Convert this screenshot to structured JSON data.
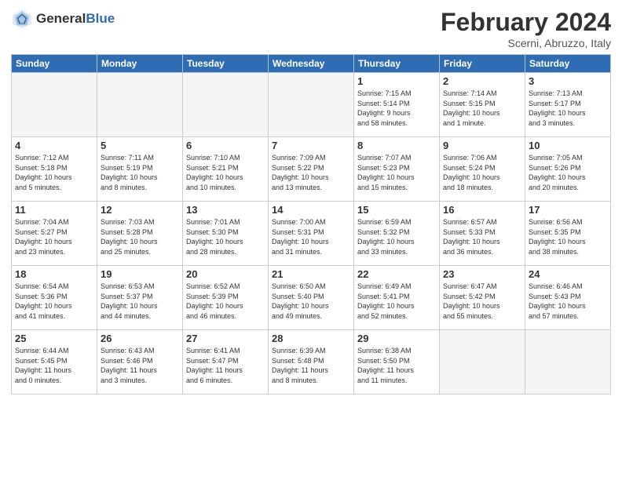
{
  "header": {
    "logo_general": "General",
    "logo_blue": "Blue",
    "month_title": "February 2024",
    "location": "Scerni, Abruzzo, Italy"
  },
  "calendar": {
    "days_of_week": [
      "Sunday",
      "Monday",
      "Tuesday",
      "Wednesday",
      "Thursday",
      "Friday",
      "Saturday"
    ],
    "weeks": [
      [
        {
          "day": "",
          "info": ""
        },
        {
          "day": "",
          "info": ""
        },
        {
          "day": "",
          "info": ""
        },
        {
          "day": "",
          "info": ""
        },
        {
          "day": "1",
          "info": "Sunrise: 7:15 AM\nSunset: 5:14 PM\nDaylight: 9 hours\nand 58 minutes."
        },
        {
          "day": "2",
          "info": "Sunrise: 7:14 AM\nSunset: 5:15 PM\nDaylight: 10 hours\nand 1 minute."
        },
        {
          "day": "3",
          "info": "Sunrise: 7:13 AM\nSunset: 5:17 PM\nDaylight: 10 hours\nand 3 minutes."
        }
      ],
      [
        {
          "day": "4",
          "info": "Sunrise: 7:12 AM\nSunset: 5:18 PM\nDaylight: 10 hours\nand 5 minutes."
        },
        {
          "day": "5",
          "info": "Sunrise: 7:11 AM\nSunset: 5:19 PM\nDaylight: 10 hours\nand 8 minutes."
        },
        {
          "day": "6",
          "info": "Sunrise: 7:10 AM\nSunset: 5:21 PM\nDaylight: 10 hours\nand 10 minutes."
        },
        {
          "day": "7",
          "info": "Sunrise: 7:09 AM\nSunset: 5:22 PM\nDaylight: 10 hours\nand 13 minutes."
        },
        {
          "day": "8",
          "info": "Sunrise: 7:07 AM\nSunset: 5:23 PM\nDaylight: 10 hours\nand 15 minutes."
        },
        {
          "day": "9",
          "info": "Sunrise: 7:06 AM\nSunset: 5:24 PM\nDaylight: 10 hours\nand 18 minutes."
        },
        {
          "day": "10",
          "info": "Sunrise: 7:05 AM\nSunset: 5:26 PM\nDaylight: 10 hours\nand 20 minutes."
        }
      ],
      [
        {
          "day": "11",
          "info": "Sunrise: 7:04 AM\nSunset: 5:27 PM\nDaylight: 10 hours\nand 23 minutes."
        },
        {
          "day": "12",
          "info": "Sunrise: 7:03 AM\nSunset: 5:28 PM\nDaylight: 10 hours\nand 25 minutes."
        },
        {
          "day": "13",
          "info": "Sunrise: 7:01 AM\nSunset: 5:30 PM\nDaylight: 10 hours\nand 28 minutes."
        },
        {
          "day": "14",
          "info": "Sunrise: 7:00 AM\nSunset: 5:31 PM\nDaylight: 10 hours\nand 31 minutes."
        },
        {
          "day": "15",
          "info": "Sunrise: 6:59 AM\nSunset: 5:32 PM\nDaylight: 10 hours\nand 33 minutes."
        },
        {
          "day": "16",
          "info": "Sunrise: 6:57 AM\nSunset: 5:33 PM\nDaylight: 10 hours\nand 36 minutes."
        },
        {
          "day": "17",
          "info": "Sunrise: 6:56 AM\nSunset: 5:35 PM\nDaylight: 10 hours\nand 38 minutes."
        }
      ],
      [
        {
          "day": "18",
          "info": "Sunrise: 6:54 AM\nSunset: 5:36 PM\nDaylight: 10 hours\nand 41 minutes."
        },
        {
          "day": "19",
          "info": "Sunrise: 6:53 AM\nSunset: 5:37 PM\nDaylight: 10 hours\nand 44 minutes."
        },
        {
          "day": "20",
          "info": "Sunrise: 6:52 AM\nSunset: 5:39 PM\nDaylight: 10 hours\nand 46 minutes."
        },
        {
          "day": "21",
          "info": "Sunrise: 6:50 AM\nSunset: 5:40 PM\nDaylight: 10 hours\nand 49 minutes."
        },
        {
          "day": "22",
          "info": "Sunrise: 6:49 AM\nSunset: 5:41 PM\nDaylight: 10 hours\nand 52 minutes."
        },
        {
          "day": "23",
          "info": "Sunrise: 6:47 AM\nSunset: 5:42 PM\nDaylight: 10 hours\nand 55 minutes."
        },
        {
          "day": "24",
          "info": "Sunrise: 6:46 AM\nSunset: 5:43 PM\nDaylight: 10 hours\nand 57 minutes."
        }
      ],
      [
        {
          "day": "25",
          "info": "Sunrise: 6:44 AM\nSunset: 5:45 PM\nDaylight: 11 hours\nand 0 minutes."
        },
        {
          "day": "26",
          "info": "Sunrise: 6:43 AM\nSunset: 5:46 PM\nDaylight: 11 hours\nand 3 minutes."
        },
        {
          "day": "27",
          "info": "Sunrise: 6:41 AM\nSunset: 5:47 PM\nDaylight: 11 hours\nand 6 minutes."
        },
        {
          "day": "28",
          "info": "Sunrise: 6:39 AM\nSunset: 5:48 PM\nDaylight: 11 hours\nand 8 minutes."
        },
        {
          "day": "29",
          "info": "Sunrise: 6:38 AM\nSunset: 5:50 PM\nDaylight: 11 hours\nand 11 minutes."
        },
        {
          "day": "",
          "info": ""
        },
        {
          "day": "",
          "info": ""
        }
      ]
    ]
  }
}
